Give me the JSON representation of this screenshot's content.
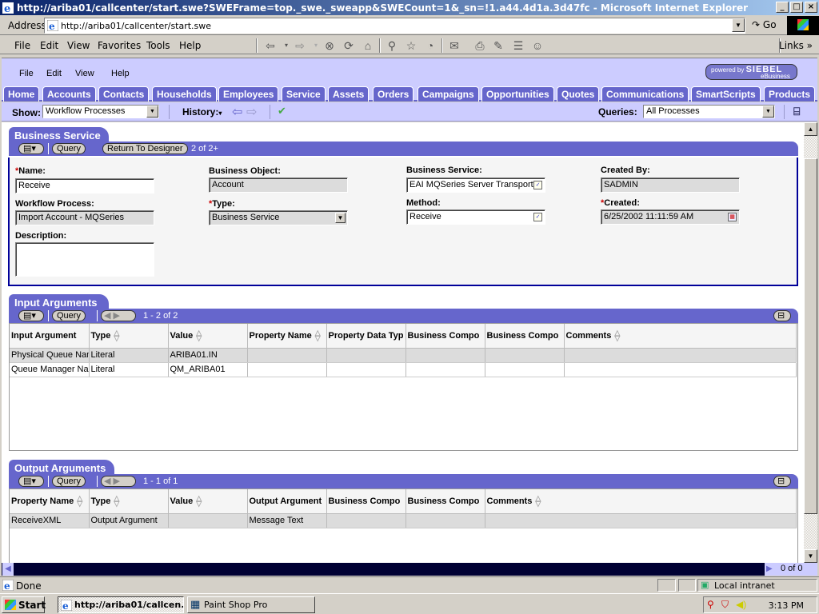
{
  "window": {
    "title": "http://ariba01/callcenter/start.swe?SWEFrame=top._swe._sweapp&SWECount=1&_sn=!1.a44.4d1a.3d47fc - Microsoft Internet Explorer",
    "controls": {
      "minimize": "_",
      "maximize": "□",
      "close": "×"
    }
  },
  "address_bar": {
    "label": "Address",
    "url": "http://ariba01/callcenter/start.swe",
    "go_label": "Go"
  },
  "ie_menu": [
    "File",
    "Edit",
    "View",
    "Favorites",
    "Tools",
    "Help"
  ],
  "ie_toolbar_icons": [
    "back-icon",
    "forward-icon",
    "stop-icon",
    "refresh-icon",
    "home-icon",
    "search-icon",
    "favorites-icon",
    "history-icon",
    "mail-icon",
    "print-icon",
    "edit-icon",
    "discuss-icon",
    "messenger-icon"
  ],
  "links_label": "Links",
  "siebel": {
    "menu": [
      "File",
      "Edit",
      "View",
      "Help"
    ],
    "logo": {
      "line1": "powered by",
      "brand": "SIEBEL",
      "line2": "eBusiness"
    },
    "tabs": [
      "Home",
      "Accounts",
      "Contacts",
      "Households",
      "Employees",
      "Service",
      "Assets",
      "Orders",
      "Campaigns",
      "Opportunities",
      "Quotes",
      "Communications",
      "SmartScripts",
      "Products"
    ],
    "show_label": "Show:",
    "show_value": "Workflow Processes",
    "history_label": "History:",
    "queries_label": "Queries:",
    "queries_value": "All Processes"
  },
  "business_service": {
    "title": "Business Service",
    "query_label": "Query",
    "return_label": "Return To Designer",
    "record_count": "2 of 2+",
    "fields": {
      "name": {
        "label": "Name:",
        "value": "Receive",
        "required": "*"
      },
      "business_object": {
        "label": "Business Object:",
        "value": "Account"
      },
      "business_service": {
        "label": "Business Service:",
        "value": "EAI MQSeries Server Transport"
      },
      "created_by": {
        "label": "Created By:",
        "value": "SADMIN"
      },
      "workflow_process": {
        "label": "Workflow Process:",
        "value": "Import Account - MQSeries"
      },
      "type": {
        "label": "Type:",
        "value": "Business Service",
        "required": "*"
      },
      "method": {
        "label": "Method:",
        "value": "Receive"
      },
      "created": {
        "label": "Created:",
        "value": "6/25/2002 11:11:59 AM",
        "required": "*"
      },
      "description": {
        "label": "Description:",
        "value": ""
      }
    }
  },
  "input_arguments": {
    "title": "Input Arguments",
    "query_label": "Query",
    "record_count": "1 - 2 of 2",
    "columns": [
      "Input Argument",
      "Type",
      "Value",
      "Property Name",
      "Property Data Typ",
      "Business Compo",
      "Business Compo",
      "Comments"
    ],
    "rows": [
      [
        "Physical Queue Nam",
        "Literal",
        "ARIBA01.IN",
        "",
        "",
        "",
        "",
        ""
      ],
      [
        "Queue Manager Nar",
        "Literal",
        "QM_ARIBA01",
        "",
        "",
        "",
        "",
        ""
      ]
    ]
  },
  "output_arguments": {
    "title": "Output Arguments",
    "query_label": "Query",
    "record_count": "1 - 1 of 1",
    "columns": [
      "Property Name",
      "Type",
      "Value",
      "Output Argument",
      "Business Compo",
      "Business Compo",
      "Comments"
    ],
    "rows": [
      [
        "ReceiveXML",
        "Output Argument",
        "",
        "Message Text",
        "",
        "",
        ""
      ]
    ]
  },
  "bottom_nav": {
    "count": "0 of 0"
  },
  "status_bar": {
    "text": "Done",
    "zone": "Local intranet"
  },
  "taskbar": {
    "start_label": "Start",
    "tasks": [
      "http://ariba01/callcen...",
      "Paint Shop Pro"
    ],
    "clock": "3:13 PM"
  }
}
